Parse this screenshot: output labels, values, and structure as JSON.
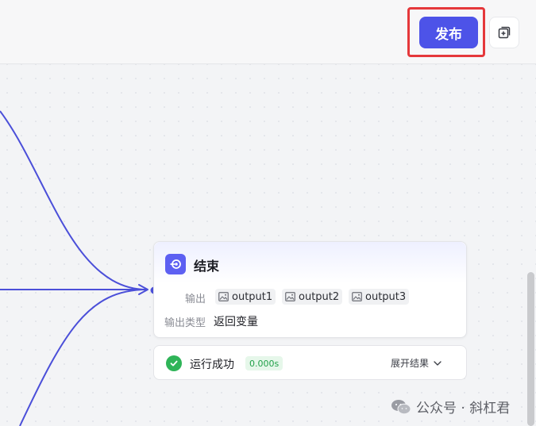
{
  "topbar": {
    "publish_label": "发布",
    "side_button_icon": "add-square-icon"
  },
  "end_node": {
    "title": "结束",
    "icon": "end-node-icon",
    "output_label": "输出",
    "outputs": [
      "output1",
      "output2",
      "output3"
    ],
    "output_type_label": "输出类型",
    "output_type_value": "返回变量"
  },
  "run_status": {
    "text": "运行成功",
    "time": "0.000s",
    "expand_label": "展开结果"
  },
  "watermark": {
    "text": "公众号 · 斜杠君"
  },
  "colors": {
    "accent": "#4d53e8",
    "edge": "#4b4fd9",
    "highlight_border": "#e5383b",
    "success": "#2fb458"
  }
}
